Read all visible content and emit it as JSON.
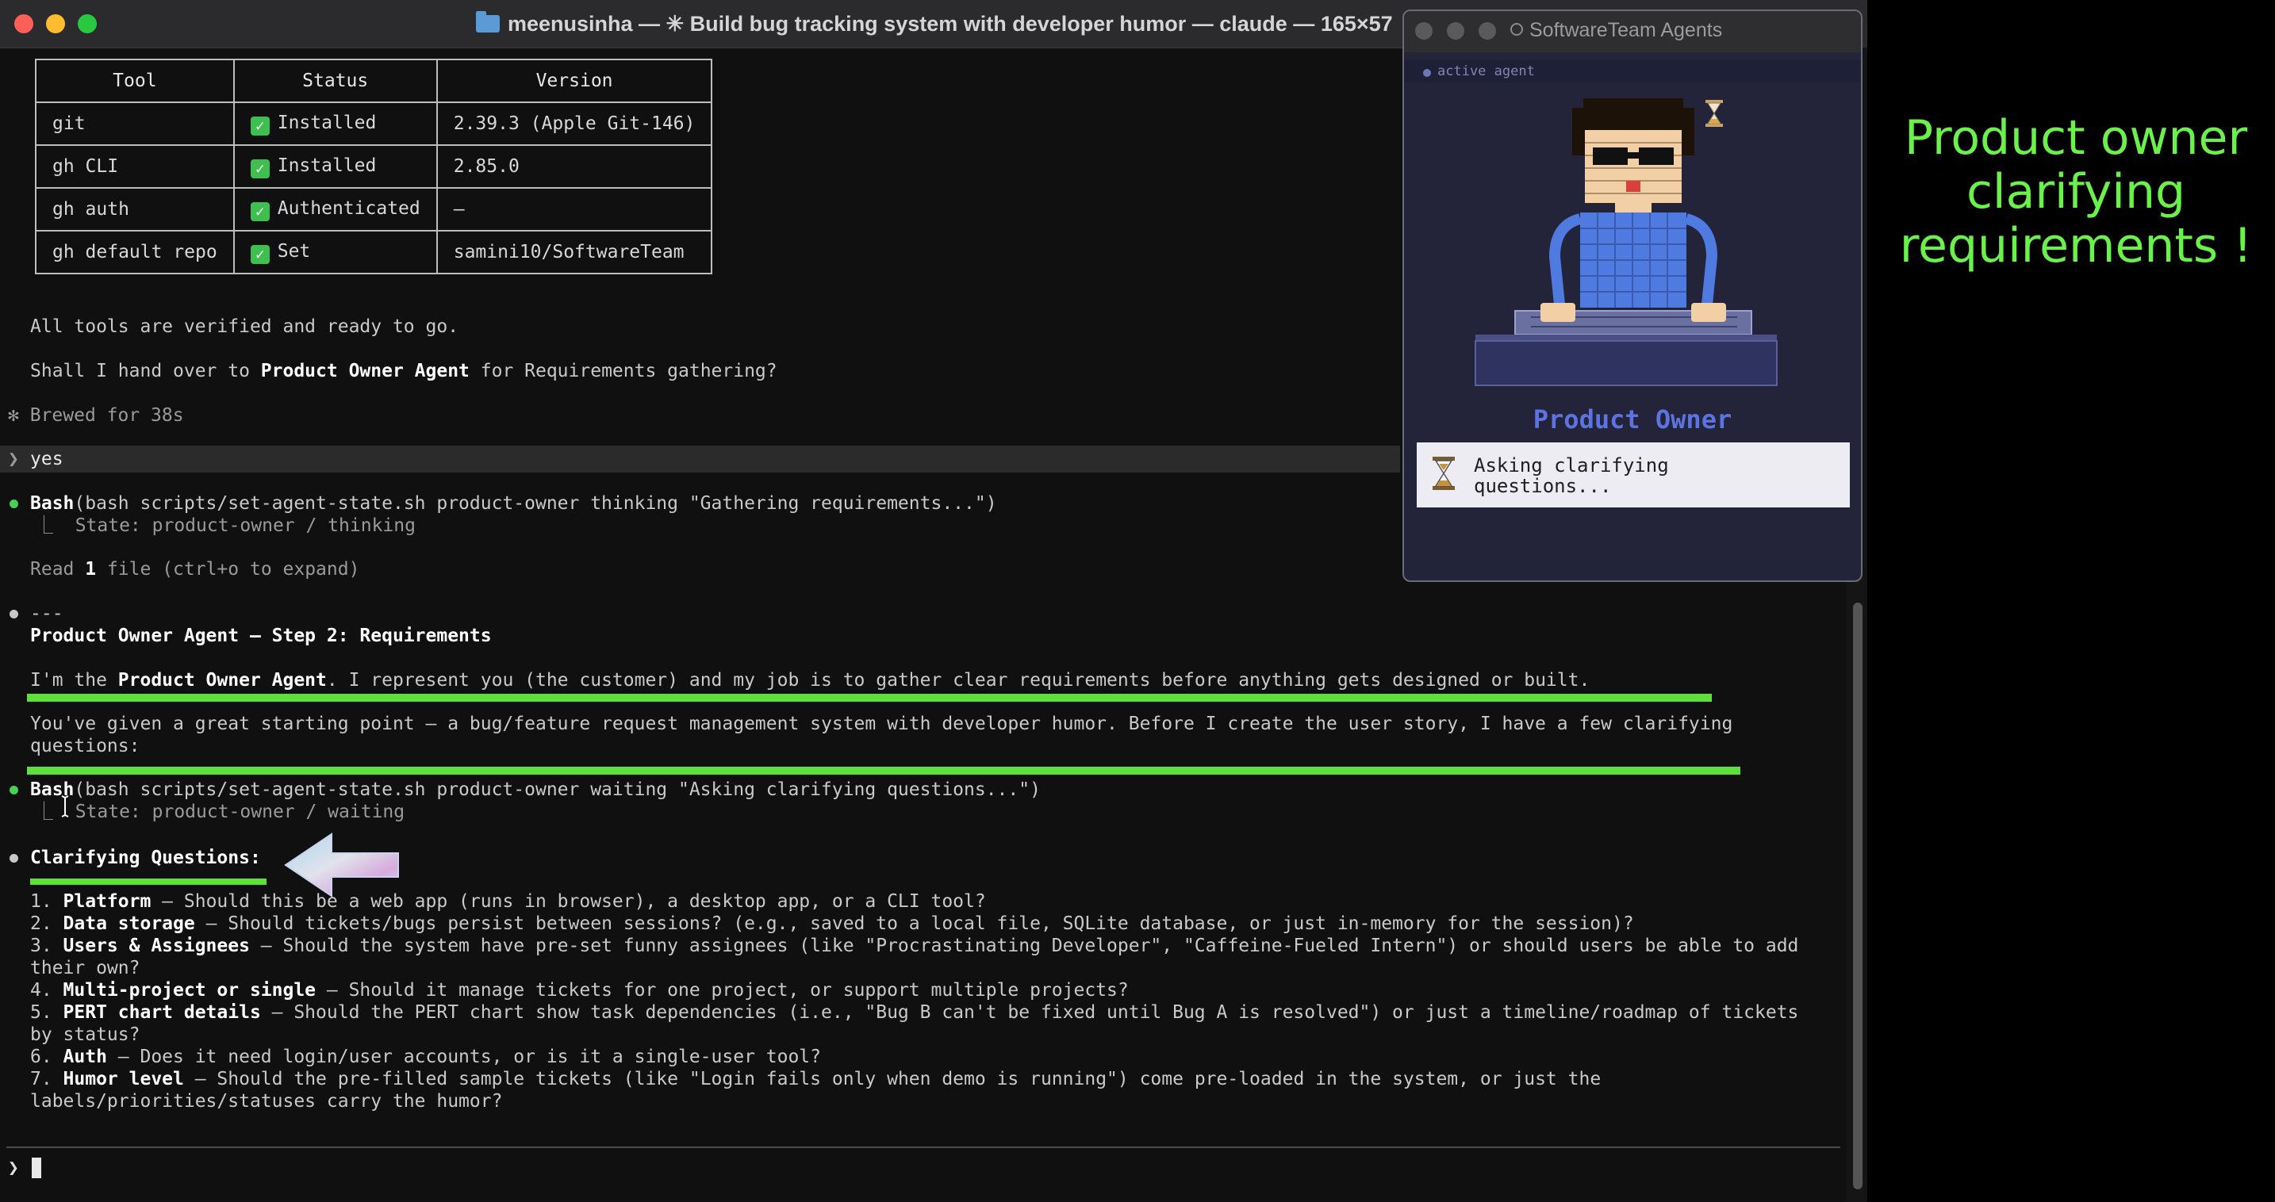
{
  "window": {
    "title": "meenusinha — ✳ Build bug tracking system with developer humor — claude — 165×57"
  },
  "tools_table": {
    "headers": [
      "Tool",
      "Status",
      "Version"
    ],
    "rows": [
      {
        "tool": "git",
        "status": "Installed",
        "version": "2.39.3 (Apple Git-146)"
      },
      {
        "tool": "gh CLI",
        "status": "Installed",
        "version": "2.85.0"
      },
      {
        "tool": "gh auth",
        "status": "Authenticated",
        "version": "–"
      },
      {
        "tool": "gh default repo",
        "status": "Set",
        "version": "samini10/SoftwareTeam"
      }
    ],
    "status_icon": "check-icon"
  },
  "transcript": {
    "all_verified": "All tools are verified and ready to go.",
    "handover_pre": "Shall I hand over to ",
    "handover_bold": "Product Owner Agent",
    "handover_post": " for Requirements gathering?",
    "brewed_star": "✻",
    "brewed": "Brewed for 38s",
    "prompt_char": "❯",
    "user_reply": "yes",
    "bash1_tool": "Bash",
    "bash1_args": "(bash scripts/set-agent-state.sh product-owner thinking \"Gathering requirements...\")",
    "bash1_result": "⎿  State: product-owner / thinking",
    "read_pre": "Read ",
    "read_count": "1",
    "read_post": " file (ctrl+o to expand)",
    "rule": "---",
    "step_heading": "Product Owner Agent — Step 2: Requirements",
    "intro_pre": "I'm the ",
    "intro_bold": "Product Owner Agent",
    "intro_post": ". I represent you (the customer) and my job is to gather clear requirements before anything gets designed or built.",
    "given_line1": "You've given a great starting point — a bug/feature request management system with developer humor. Before I create the user story, I have a few clarifying",
    "given_line2": "questions:",
    "bash2_tool": "Bash",
    "bash2_args": "(bash scripts/set-agent-state.sh product-owner waiting \"Asking clarifying questions...\")",
    "bash2_result": "⎿  State: product-owner / waiting",
    "questions_heading": "Clarifying Questions:",
    "questions": [
      {
        "n": "1. ",
        "bold": "Platform",
        "text": " — Should this be a web app (runs in browser), a desktop app, or a CLI tool?"
      },
      {
        "n": "2. ",
        "bold": "Data storage",
        "text": " — Should tickets/bugs persist between sessions? (e.g., saved to a local file, SQLite database, or just in-memory for the session)?"
      },
      {
        "n": "3. ",
        "bold": "Users & Assignees",
        "text": " — Should the system have pre-set funny assignees (like \"Procrastinating Developer\", \"Caffeine-Fueled Intern\") or should users be able to add",
        "cont": "their own?"
      },
      {
        "n": "4. ",
        "bold": "Multi-project or single",
        "text": " — Should it manage tickets for one project, or support multiple projects?"
      },
      {
        "n": "5. ",
        "bold": "PERT chart details",
        "text": " — Should the PERT chart show task dependencies (i.e., \"Bug B can't be fixed until Bug A is resolved\") or just a timeline/roadmap of tickets",
        "cont": "by status?"
      },
      {
        "n": "6. ",
        "bold": "Auth",
        "text": " — Does it need login/user accounts, or is it a single-user tool?"
      },
      {
        "n": "7. ",
        "bold": "Humor level",
        "text": " — Should the pre-filled sample tickets (like \"Login fails only when demo is running\") come pre-loaded in the system, or just the",
        "cont": "labels/priorities/statuses carry the humor?"
      }
    ]
  },
  "agent_window": {
    "title": "SoftwareTeam Agents",
    "status": "active agent",
    "role": "Product Owner",
    "message": "Asking clarifying\nquestions..."
  },
  "caption": {
    "line1": "Product owner",
    "line2": "clarifying",
    "line3": "requirements !"
  },
  "colors": {
    "terminal_bg": "#101010",
    "highlight_green": "#5ee03b",
    "caption_green": "#6af24a",
    "agent_accent": "#5d74e0"
  }
}
